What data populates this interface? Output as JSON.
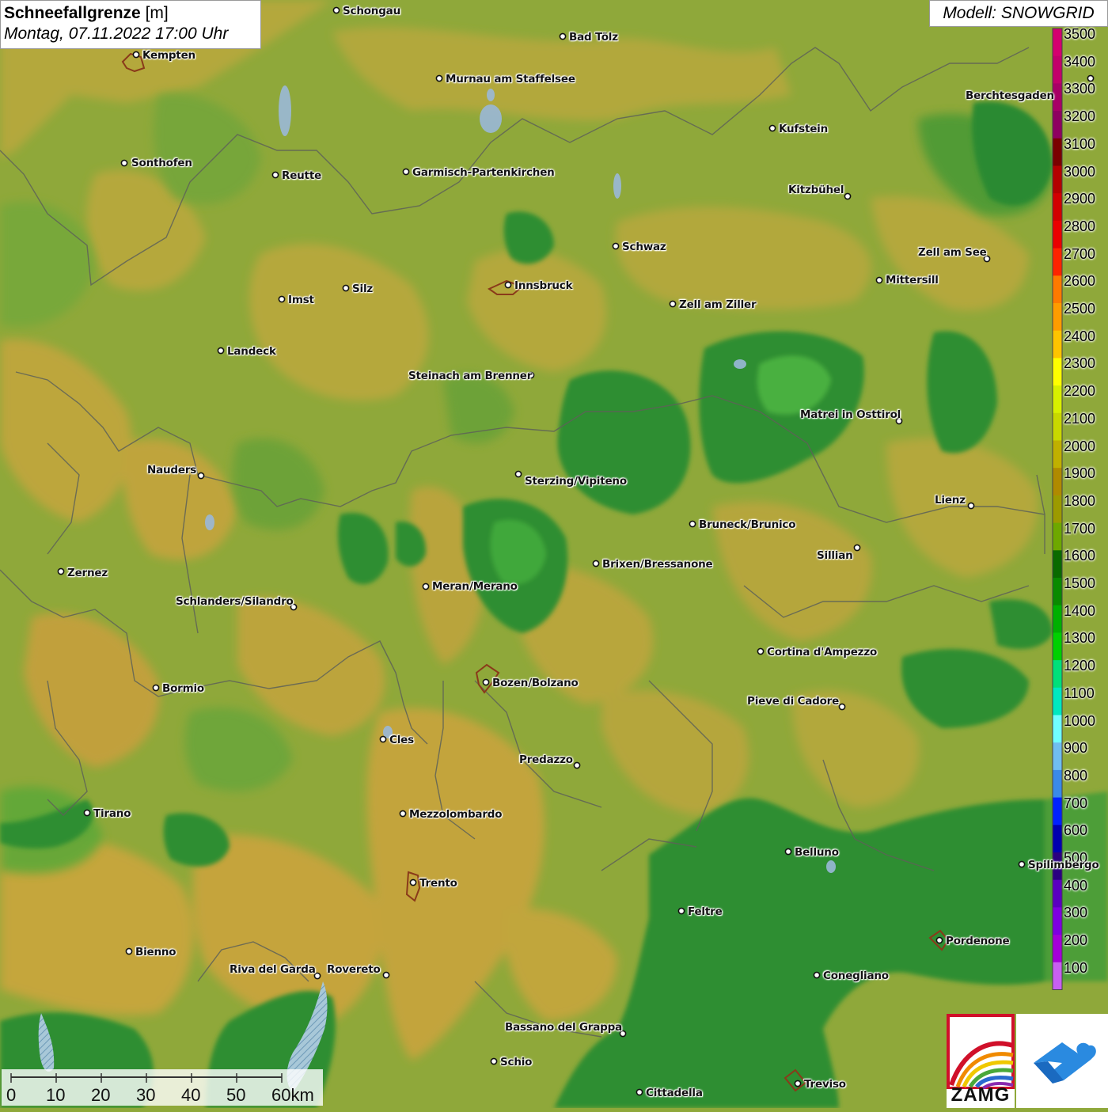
{
  "header": {
    "title": "Schneefallgrenze",
    "unit": "[m]",
    "datetime": "Montag, 07.11.2022 17:00 Uhr",
    "model": "Modell: SNOWGRID"
  },
  "legend": {
    "entries": [
      {
        "label": "3500",
        "color": "#d4006f"
      },
      {
        "label": "3400",
        "color": "#c2006a"
      },
      {
        "label": "3300",
        "color": "#a80066"
      },
      {
        "label": "3200",
        "color": "#8e0060"
      },
      {
        "label": "3100",
        "color": "#7a0000"
      },
      {
        "label": "3000",
        "color": "#b40000"
      },
      {
        "label": "2900",
        "color": "#d20000"
      },
      {
        "label": "2800",
        "color": "#ea0000"
      },
      {
        "label": "2700",
        "color": "#ff2400"
      },
      {
        "label": "2600",
        "color": "#ff7a00"
      },
      {
        "label": "2500",
        "color": "#ff9c00"
      },
      {
        "label": "2400",
        "color": "#ffc400"
      },
      {
        "label": "2300",
        "color": "#ffff00"
      },
      {
        "label": "2200",
        "color": "#d8f000"
      },
      {
        "label": "2100",
        "color": "#c8d800"
      },
      {
        "label": "2000",
        "color": "#c0b000"
      },
      {
        "label": "1900",
        "color": "#b08a00"
      },
      {
        "label": "1800",
        "color": "#9c9a00"
      },
      {
        "label": "1700",
        "color": "#6ea800"
      },
      {
        "label": "1600",
        "color": "#0a6a00"
      },
      {
        "label": "1500",
        "color": "#0a8a00"
      },
      {
        "label": "1400",
        "color": "#00b000"
      },
      {
        "label": "1300",
        "color": "#00d000"
      },
      {
        "label": "1200",
        "color": "#00e07a"
      },
      {
        "label": "1100",
        "color": "#00e8c0"
      },
      {
        "label": "1000",
        "color": "#70ffff"
      },
      {
        "label": "900",
        "color": "#70bef0"
      },
      {
        "label": "800",
        "color": "#3a8ae8"
      },
      {
        "label": "700",
        "color": "#0022ff"
      },
      {
        "label": "600",
        "color": "#0000b0"
      },
      {
        "label": "500",
        "color": "#2a0080"
      },
      {
        "label": "400",
        "color": "#5a00c0"
      },
      {
        "label": "300",
        "color": "#7e00e0"
      },
      {
        "label": "200",
        "color": "#a400d8"
      },
      {
        "label": "100",
        "color": "#c860f0"
      }
    ]
  },
  "cities": [
    {
      "name": "Schongau"
    },
    {
      "name": "Kempten"
    },
    {
      "name": "Bad Tölz"
    },
    {
      "name": "Murnau am Staffelsee"
    },
    {
      "name": "Berchtesgaden"
    },
    {
      "name": "Kufstein"
    },
    {
      "name": "Sonthofen"
    },
    {
      "name": "Reutte"
    },
    {
      "name": "Garmisch-Partenkirchen"
    },
    {
      "name": "Kitzbühel"
    },
    {
      "name": "Schwaz"
    },
    {
      "name": "Zell am See"
    },
    {
      "name": "Mittersill"
    },
    {
      "name": "Innsbruck"
    },
    {
      "name": "Silz"
    },
    {
      "name": "Imst"
    },
    {
      "name": "Zell am Ziller"
    },
    {
      "name": "Landeck"
    },
    {
      "name": "Steinach am Brenner"
    },
    {
      "name": "Matrei in Osttirol"
    },
    {
      "name": "Nauders"
    },
    {
      "name": "Sterzing/Vipiteno"
    },
    {
      "name": "Lienz"
    },
    {
      "name": "Bruneck/Brunico"
    },
    {
      "name": "Sillian"
    },
    {
      "name": "Brixen/Bressanone"
    },
    {
      "name": "Zernez"
    },
    {
      "name": "Meran/Merano"
    },
    {
      "name": "Schlanders/Silandro"
    },
    {
      "name": "Cortina d'Ampezzo"
    },
    {
      "name": "Bozen/Bolzano"
    },
    {
      "name": "Bormio"
    },
    {
      "name": "Pieve di Cadore"
    },
    {
      "name": "Cles"
    },
    {
      "name": "Predazzo"
    },
    {
      "name": "Tirano"
    },
    {
      "name": "Mezzolombardo"
    },
    {
      "name": "Belluno"
    },
    {
      "name": "Spilimbergo"
    },
    {
      "name": "Trento"
    },
    {
      "name": "Feltre"
    },
    {
      "name": "Pordenone"
    },
    {
      "name": "Bienno"
    },
    {
      "name": "Riva del Garda"
    },
    {
      "name": "Rovereto"
    },
    {
      "name": "Conegliano"
    },
    {
      "name": "Bassano del Grappa"
    },
    {
      "name": "Schio"
    },
    {
      "name": "Treviso"
    },
    {
      "name": "Cittadella"
    }
  ],
  "scale": {
    "labels": [
      "0",
      "10",
      "20",
      "30",
      "40",
      "50",
      "60km"
    ]
  },
  "logos": {
    "zamg": "ZAMG",
    "secondary_icon": "wave-cloud-icon"
  },
  "colors": {
    "base_olive": "#8fa83a",
    "yellow_olive": "#b3a83a",
    "ochre": "#c4a43a",
    "green": "#6faa3a",
    "mid_green": "#3e9a38",
    "dark_green": "#2a8a30",
    "bright_green": "#40c040",
    "lake": "#9ab8d8",
    "border": "#666666"
  }
}
